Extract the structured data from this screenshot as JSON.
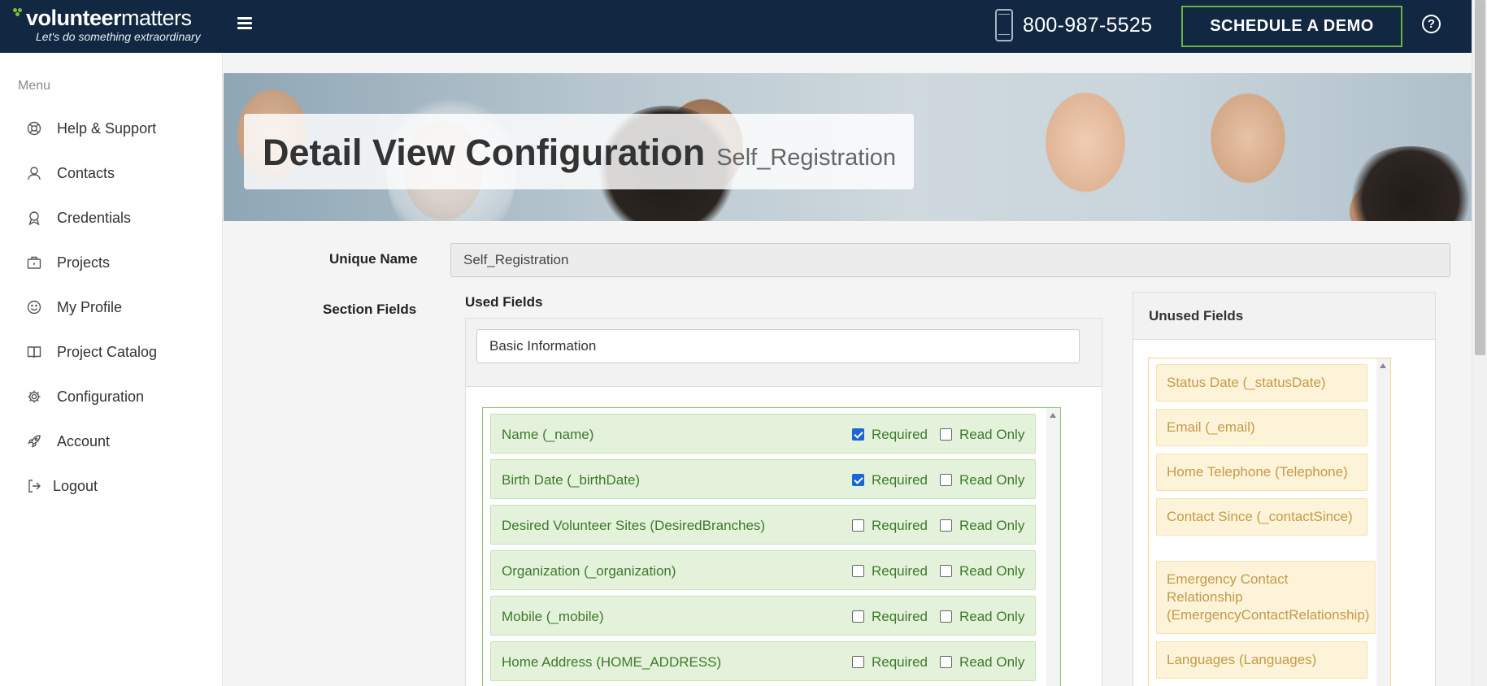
{
  "brand": {
    "name_bold": "volunteer",
    "name_light": "matters",
    "tagline": "Let's do something extraordinary"
  },
  "header": {
    "phone": "800-987-5525",
    "demo_label": "SCHEDULE A DEMO",
    "help_symbol": "?"
  },
  "sidebar": {
    "menu_label": "Menu",
    "items": [
      {
        "label": "Help & Support",
        "icon": "lifebuoy-icon"
      },
      {
        "label": "Contacts",
        "icon": "user-icon"
      },
      {
        "label": "Credentials",
        "icon": "award-icon"
      },
      {
        "label": "Projects",
        "icon": "briefcase-icon"
      },
      {
        "label": "My Profile",
        "icon": "smile-icon"
      },
      {
        "label": "Project Catalog",
        "icon": "book-icon"
      },
      {
        "label": "Configuration",
        "icon": "gear-icon"
      },
      {
        "label": "Account",
        "icon": "rocket-icon"
      },
      {
        "label": "Logout",
        "icon": "logout-icon"
      }
    ]
  },
  "page": {
    "title": "Detail View Configuration",
    "subtitle": "Self_Registration"
  },
  "form": {
    "unique_name_label": "Unique Name",
    "unique_name_value": "Self_Registration",
    "section_fields_label": "Section Fields",
    "used_fields_label": "Used Fields",
    "section_name_value": "Basic Information",
    "required_label": "Required",
    "read_only_label": "Read Only",
    "used_fields": [
      {
        "name": "Name (_name)",
        "required": true,
        "read_only": false
      },
      {
        "name": "Birth Date (_birthDate)",
        "required": true,
        "read_only": false
      },
      {
        "name": "Desired Volunteer Sites (DesiredBranches)",
        "required": false,
        "read_only": false
      },
      {
        "name": "Organization (_organization)",
        "required": false,
        "read_only": false
      },
      {
        "name": "Mobile (_mobile)",
        "required": false,
        "read_only": false
      },
      {
        "name": "Home Address (HOME_ADDRESS)",
        "required": false,
        "read_only": false
      }
    ],
    "unused_fields_label": "Unused Fields",
    "unused_fields": [
      "Status Date (_statusDate)",
      "Email (_email)",
      "Home Telephone (Telephone)",
      "Contact Since (_contactSince)",
      "Emergency Contact Relationship (EmergencyContactRelationship)",
      "Languages (Languages)"
    ]
  },
  "colors": {
    "topbar": "#112742",
    "accent_green": "#6cb33f",
    "used_field_bg": "#e4f2dc",
    "used_field_text": "#3d7a2a",
    "unused_field_bg": "#fdf3d8",
    "unused_field_text": "#c59a4a"
  }
}
